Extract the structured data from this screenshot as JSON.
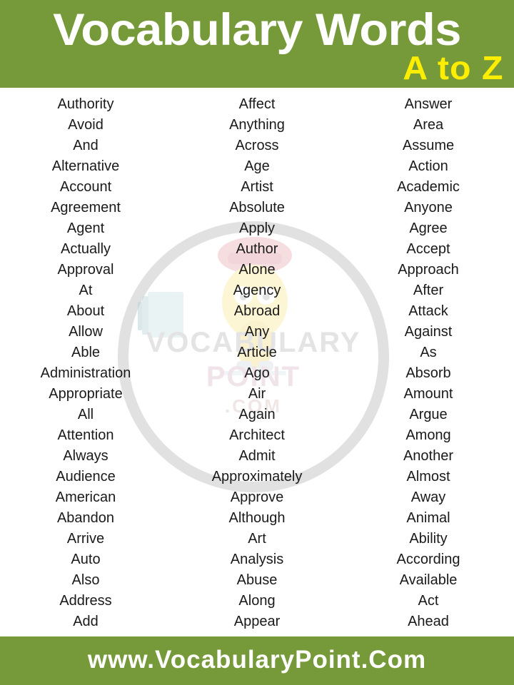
{
  "header": {
    "title": "Vocabulary Words",
    "subtitle": "A to Z",
    "background_color": "#769939",
    "title_color": "#ffffff",
    "subtitle_color": "#fdee00"
  },
  "watermark": {
    "line1": "VOCABULARY",
    "line2": "POINT",
    "line3": ".COM",
    "ring_color": "#dcdcdc"
  },
  "columns": [
    {
      "index": 1,
      "words": [
        "Authority",
        "Avoid",
        "And",
        "Alternative",
        "Account",
        "Agreement",
        "Agent",
        "Actually",
        "Approval",
        "At",
        "About",
        "Allow",
        "Able",
        "Administration",
        "Appropriate",
        "All",
        "Attention",
        "Always",
        "Audience",
        "American",
        "Abandon",
        "Arrive",
        "Auto",
        "Also",
        "Address",
        "Add"
      ]
    },
    {
      "index": 2,
      "words": [
        "Affect",
        "Anything",
        "Across",
        "Age",
        "Artist",
        "Absolute",
        "Apply",
        "Author",
        "Alone",
        "Agency",
        "Abroad",
        "Any",
        "Article",
        "Ago",
        "Air",
        "Again",
        "Architect",
        "Admit",
        "Approximately",
        "Approve",
        "Although",
        "Art",
        "Analysis",
        "Abuse",
        "Along",
        "Appear"
      ]
    },
    {
      "index": 3,
      "words": [
        "Answer",
        "Area",
        "Assume",
        "Action",
        "Academic",
        "Anyone",
        "Agree",
        "Accept",
        "Approach",
        "After",
        "Attack",
        "Against",
        "As",
        "Absorb",
        "Amount",
        "Argue",
        "Among",
        "Another",
        "Almost",
        "Away",
        "Animal",
        "Ability",
        "According",
        "Available",
        "Act",
        "Ahead"
      ]
    }
  ],
  "footer": {
    "website": "www.VocabularyPoint.Com",
    "background_color": "#769939",
    "text_color": "#ffffff"
  }
}
